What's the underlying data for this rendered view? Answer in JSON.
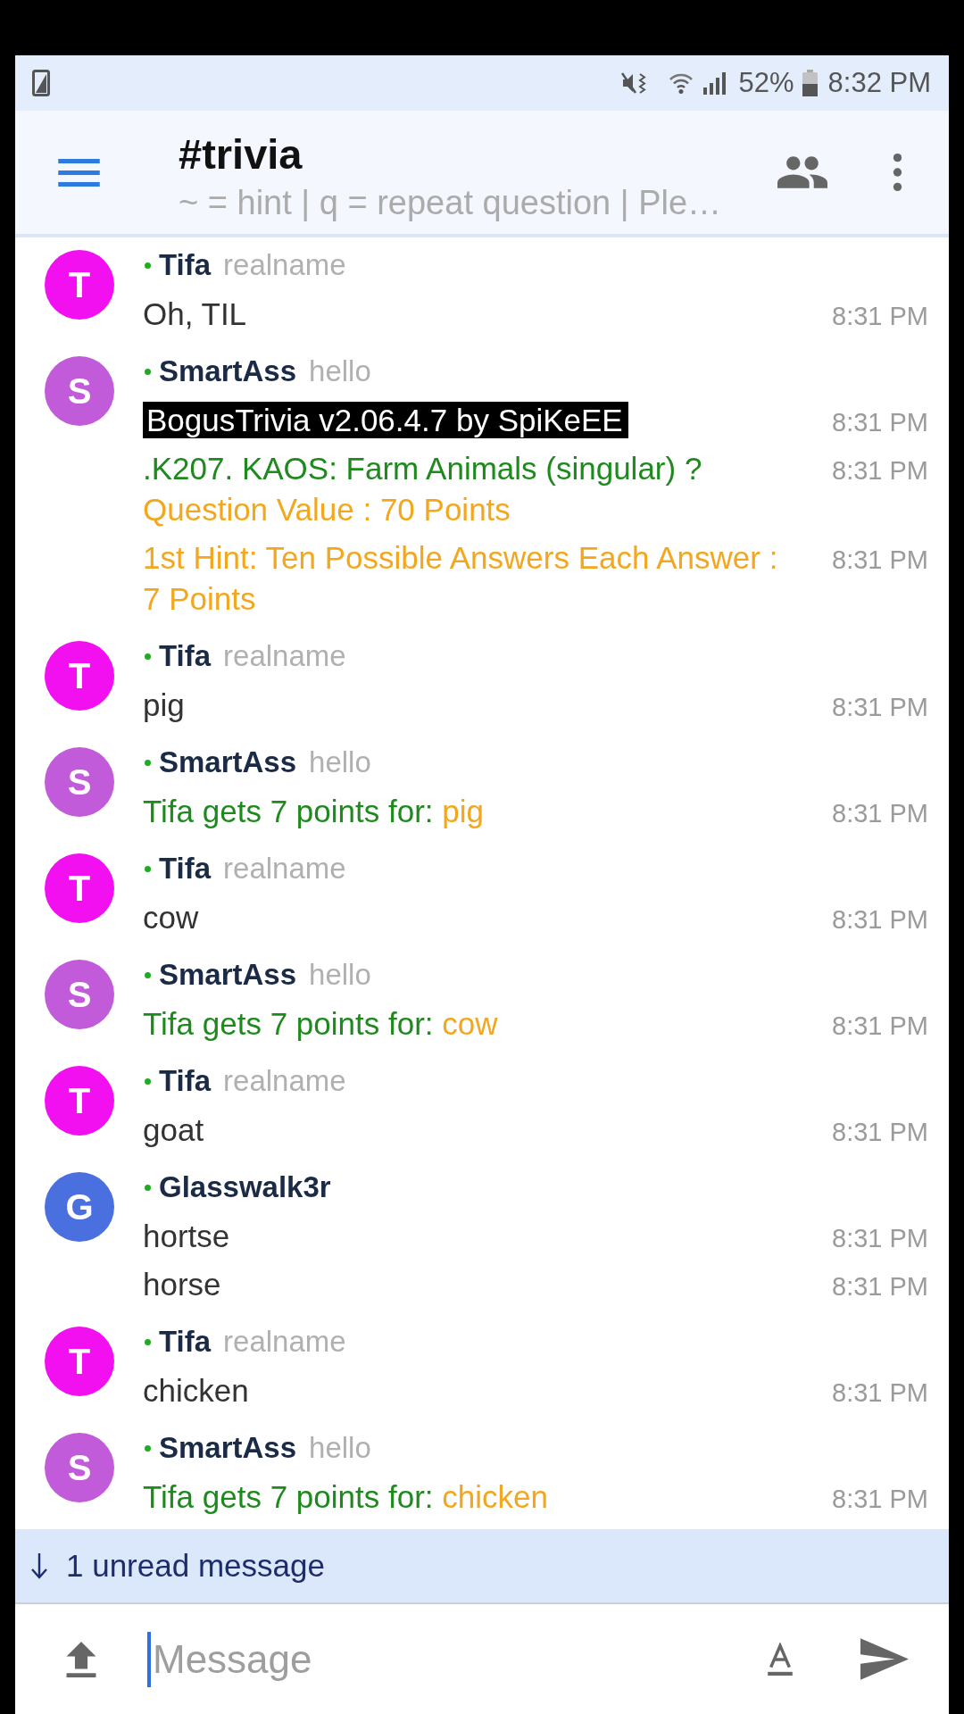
{
  "status_bar": {
    "battery": "52%",
    "time": "8:32 PM"
  },
  "header": {
    "title": "#trivia",
    "topic": "~ = hint | q = repeat question | Ple…"
  },
  "messages": [
    {
      "sender": "Tifa",
      "initial": "T",
      "color": "#f20ff0",
      "online": true,
      "realname": "realname",
      "items": [
        {
          "time": "8:31 PM",
          "lines": [
            {
              "spans": [
                {
                  "kind": "plain",
                  "text": "Oh, TIL",
                  "color": "#333333"
                }
              ]
            }
          ]
        }
      ]
    },
    {
      "sender": "SmartAss",
      "initial": "S",
      "color": "#c25bd9",
      "online": true,
      "realname": "hello",
      "items": [
        {
          "time": "8:31 PM",
          "lines": [
            {
              "spans": [
                {
                  "kind": "reverse",
                  "text": "BogusTrivia v2.06.4.7 by SpiKeEE",
                  "color": "#000000"
                }
              ]
            }
          ]
        },
        {
          "time": "8:31 PM",
          "lines": [
            {
              "spans": [
                {
                  "kind": "plain",
                  "text": ".K207. KAOS: Farm Animals (singular) ?",
                  "color": "#1e8a1e"
                }
              ]
            },
            {
              "spans": [
                {
                  "kind": "plain",
                  "text": "Question Value : 70 Points",
                  "color": "#f2a71e"
                }
              ]
            }
          ]
        },
        {
          "time": "8:31 PM",
          "lines": [
            {
              "spans": [
                {
                  "kind": "plain",
                  "text": "1st Hint: Ten Possible Answers Each Answer : 7 Points",
                  "color": "#f2a71e"
                }
              ]
            }
          ]
        }
      ]
    },
    {
      "sender": "Tifa",
      "initial": "T",
      "color": "#f20ff0",
      "online": true,
      "realname": "realname",
      "items": [
        {
          "time": "8:31 PM",
          "lines": [
            {
              "spans": [
                {
                  "kind": "plain",
                  "text": "pig",
                  "color": "#333333"
                }
              ]
            }
          ]
        }
      ]
    },
    {
      "sender": "SmartAss",
      "initial": "S",
      "color": "#c25bd9",
      "online": true,
      "realname": "hello",
      "items": [
        {
          "time": "8:31 PM",
          "lines": [
            {
              "spans": [
                {
                  "kind": "plain",
                  "text": "Tifa gets 7 points for: ",
                  "color": "#1e8a1e"
                },
                {
                  "kind": "plain",
                  "text": "pig",
                  "color": "#f2a71e"
                }
              ]
            }
          ]
        }
      ]
    },
    {
      "sender": "Tifa",
      "initial": "T",
      "color": "#f20ff0",
      "online": true,
      "realname": "realname",
      "items": [
        {
          "time": "8:31 PM",
          "lines": [
            {
              "spans": [
                {
                  "kind": "plain",
                  "text": "cow",
                  "color": "#333333"
                }
              ]
            }
          ]
        }
      ]
    },
    {
      "sender": "SmartAss",
      "initial": "S",
      "color": "#c25bd9",
      "online": true,
      "realname": "hello",
      "items": [
        {
          "time": "8:31 PM",
          "lines": [
            {
              "spans": [
                {
                  "kind": "plain",
                  "text": "Tifa gets 7 points for: ",
                  "color": "#1e8a1e"
                },
                {
                  "kind": "plain",
                  "text": "cow",
                  "color": "#f2a71e"
                }
              ]
            }
          ]
        }
      ]
    },
    {
      "sender": "Tifa",
      "initial": "T",
      "color": "#f20ff0",
      "online": true,
      "realname": "realname",
      "items": [
        {
          "time": "8:31 PM",
          "lines": [
            {
              "spans": [
                {
                  "kind": "plain",
                  "text": "goat",
                  "color": "#333333"
                }
              ]
            }
          ]
        }
      ]
    },
    {
      "sender": "Glasswalk3r",
      "initial": "G",
      "color": "#4a70e0",
      "online": true,
      "items": [
        {
          "time": "8:31 PM",
          "lines": [
            {
              "spans": [
                {
                  "kind": "plain",
                  "text": "hortse",
                  "color": "#333333"
                }
              ]
            }
          ]
        },
        {
          "time": "8:31 PM",
          "lines": [
            {
              "spans": [
                {
                  "kind": "plain",
                  "text": "horse",
                  "color": "#333333"
                }
              ]
            }
          ]
        }
      ]
    },
    {
      "sender": "Tifa",
      "initial": "T",
      "color": "#f20ff0",
      "online": true,
      "realname": "realname",
      "items": [
        {
          "time": "8:31 PM",
          "lines": [
            {
              "spans": [
                {
                  "kind": "plain",
                  "text": "chicken",
                  "color": "#333333"
                }
              ]
            }
          ]
        }
      ]
    },
    {
      "sender": "SmartAss",
      "initial": "S",
      "color": "#c25bd9",
      "online": true,
      "realname": "hello",
      "items": [
        {
          "time": "8:31 PM",
          "lines": [
            {
              "spans": [
                {
                  "kind": "plain",
                  "text": "Tifa gets 7 points for: ",
                  "color": "#1e8a1e"
                },
                {
                  "kind": "plain",
                  "text": "chicken",
                  "color": "#f2a71e"
                }
              ]
            }
          ]
        }
      ]
    }
  ],
  "unread_bar": {
    "label": "1 unread message"
  },
  "composer": {
    "placeholder": "Message"
  }
}
